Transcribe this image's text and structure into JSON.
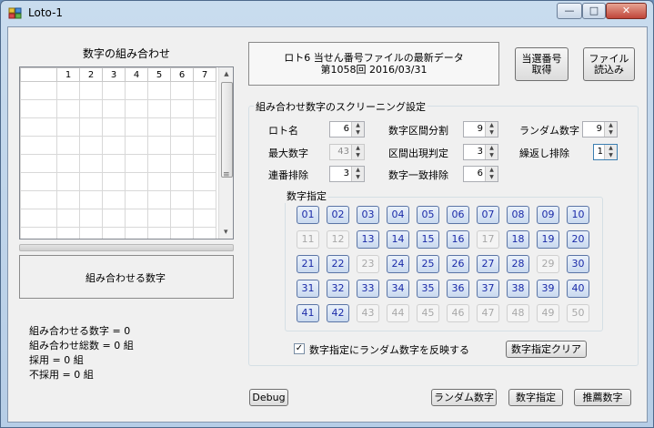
{
  "window": {
    "title": "Loto-1",
    "min_glyph": "—",
    "max_glyph": "□",
    "close_glyph": "✕"
  },
  "combo_panel": {
    "title": "数字の組み合わせ",
    "grid_headers": [
      "",
      "1",
      "2",
      "3",
      "4",
      "5",
      "6",
      "7"
    ],
    "scroll_glyph": "≡",
    "scroll_down_glyph": "▾"
  },
  "combine_label": "組み合わせる数字",
  "stats": [
    "組み合わせる数字 = 0",
    "組み合わせ総数 = 0 組",
    "採用 = 0 組",
    "不採用 = 0 組"
  ],
  "file_info": {
    "line1": "ロト6 当せん番号ファイルの最新データ",
    "line2": "第1058回  2016/03/31"
  },
  "buttons": {
    "fetch_line1": "当選番号",
    "fetch_line2": "取得",
    "load_line1": "ファイル",
    "load_line2": "読込み",
    "debug": "Debug",
    "random": "ランダム数字",
    "specify": "数字指定",
    "recommend": "推薦数字",
    "clear": "数字指定クリア"
  },
  "screening": {
    "title": "組み合わせ数字のスクリーニング設定",
    "loto_name_label": "ロト名",
    "loto_name_value": "6",
    "max_number_label": "最大数字",
    "max_number_value": "43",
    "consecutive_label": "連番排除",
    "consecutive_value": "3",
    "interval_split_label": "数字区間分割",
    "interval_split_value": "9",
    "interval_appear_label": "区間出現判定",
    "interval_appear_value": "3",
    "match_exclude_label": "数字一致排除",
    "match_exclude_value": "6",
    "random_number_label": "ランダム数字",
    "random_number_value": "9",
    "repeat_exclude_label": "繰返し排除",
    "repeat_exclude_value": "1"
  },
  "number_specify": {
    "title": "数字指定",
    "numbers": [
      "01",
      "02",
      "03",
      "04",
      "05",
      "06",
      "07",
      "08",
      "09",
      "10",
      "11",
      "12",
      "13",
      "14",
      "15",
      "16",
      "17",
      "18",
      "19",
      "20",
      "21",
      "22",
      "23",
      "24",
      "25",
      "26",
      "27",
      "28",
      "29",
      "30",
      "31",
      "32",
      "33",
      "34",
      "35",
      "36",
      "37",
      "38",
      "39",
      "40",
      "41",
      "42",
      "43",
      "44",
      "45",
      "46",
      "47",
      "48",
      "49",
      "50"
    ],
    "disabled": [
      "11",
      "12",
      "17",
      "23",
      "29",
      "43",
      "44",
      "45",
      "46",
      "47",
      "48",
      "49",
      "50"
    ],
    "checkbox_label": "数字指定にランダム数字を反映する",
    "checkbox_checked": true,
    "check_glyph": "✓"
  }
}
